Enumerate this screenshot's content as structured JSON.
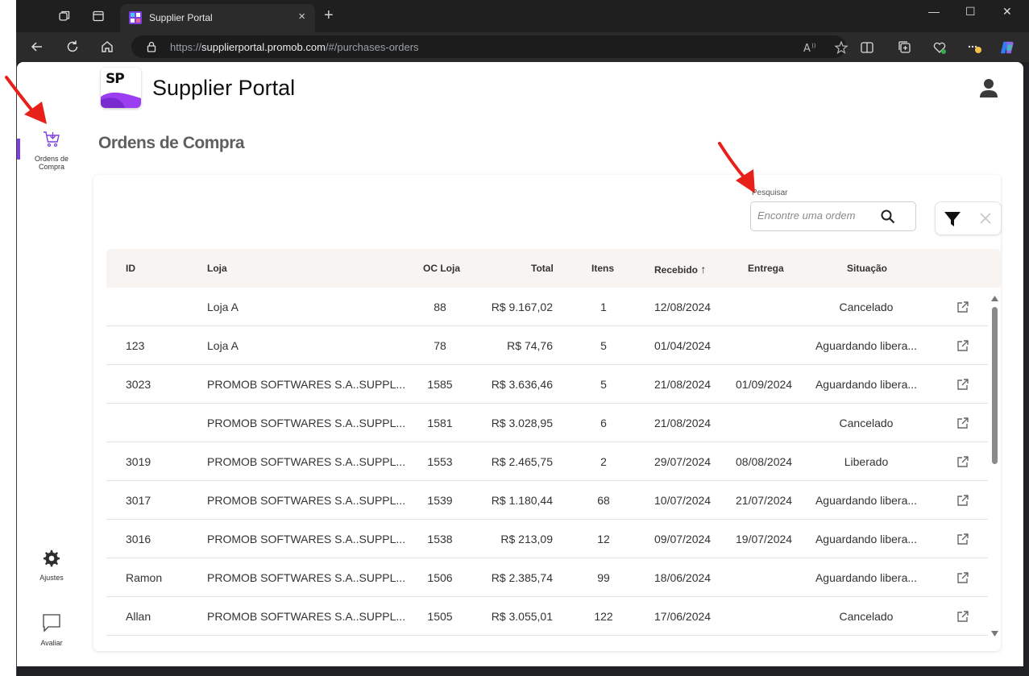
{
  "browser": {
    "tab_title": "Supplier Portal",
    "tab_close": "×",
    "new_tab": "+",
    "url_scheme": "https://",
    "url_host": "supplierportal.promob.com",
    "url_path": "/#/purchases-orders",
    "window_controls": [
      "—",
      "☐",
      "✕"
    ]
  },
  "app": {
    "logo_text": "SP",
    "title": "Supplier Portal"
  },
  "sidebar": {
    "items": [
      {
        "label": "Ordens de Compra",
        "icon": "cart-icon",
        "active": true
      },
      {
        "label": "Ajustes",
        "icon": "gear-icon"
      },
      {
        "label": "Avaliar",
        "icon": "chat-icon"
      }
    ]
  },
  "page": {
    "title": "Ordens de Compra"
  },
  "search": {
    "label": "Pesquisar",
    "placeholder": "Encontre uma ordem"
  },
  "table": {
    "columns": [
      "ID",
      "Loja",
      "OC Loja",
      "Total",
      "Itens",
      "Recebido",
      "Entrega",
      "Situação"
    ],
    "sort_indicator": "↑",
    "rows": [
      {
        "id": "",
        "loja": "Loja  A",
        "oc_loja": "88",
        "total": "R$ 9.167,02",
        "itens": "1",
        "recebido": "12/08/2024",
        "entrega": "",
        "situacao": "Cancelado"
      },
      {
        "id": "123",
        "loja": "Loja  A",
        "oc_loja": "78",
        "total": "R$ 74,76",
        "itens": "5",
        "recebido": "01/04/2024",
        "entrega": "",
        "situacao": "Aguardando libera..."
      },
      {
        "id": "3023",
        "loja": "PROMOB SOFTWARES S.A..SUPPL...",
        "oc_loja": "1585",
        "total": "R$ 3.636,46",
        "itens": "5",
        "recebido": "21/08/2024",
        "entrega": "01/09/2024",
        "situacao": "Aguardando libera..."
      },
      {
        "id": "",
        "loja": "PROMOB SOFTWARES S.A..SUPPL...",
        "oc_loja": "1581",
        "total": "R$ 3.028,95",
        "itens": "6",
        "recebido": "21/08/2024",
        "entrega": "",
        "situacao": "Cancelado"
      },
      {
        "id": "3019",
        "loja": "PROMOB SOFTWARES S.A..SUPPL...",
        "oc_loja": "1553",
        "total": "R$ 2.465,75",
        "itens": "2",
        "recebido": "29/07/2024",
        "entrega": "08/08/2024",
        "situacao": "Liberado"
      },
      {
        "id": "3017",
        "loja": "PROMOB SOFTWARES S.A..SUPPL...",
        "oc_loja": "1539",
        "total": "R$ 1.180,44",
        "itens": "68",
        "recebido": "10/07/2024",
        "entrega": "21/07/2024",
        "situacao": "Aguardando libera..."
      },
      {
        "id": "3016",
        "loja": "PROMOB SOFTWARES S.A..SUPPL...",
        "oc_loja": "1538",
        "total": "R$ 213,09",
        "itens": "12",
        "recebido": "09/07/2024",
        "entrega": "19/07/2024",
        "situacao": "Aguardando libera..."
      },
      {
        "id": "Ramon",
        "loja": "PROMOB SOFTWARES S.A..SUPPL...",
        "oc_loja": "1506",
        "total": "R$ 2.385,74",
        "itens": "99",
        "recebido": "18/06/2024",
        "entrega": "",
        "situacao": "Aguardando libera..."
      },
      {
        "id": "Allan",
        "loja": "PROMOB SOFTWARES S.A..SUPPL...",
        "oc_loja": "1505",
        "total": "R$ 3.055,01",
        "itens": "122",
        "recebido": "17/06/2024",
        "entrega": "",
        "situacao": "Cancelado"
      }
    ]
  },
  "colors": {
    "accent": "#7b3fe4",
    "annotation": "#e8201a",
    "table_header_bg": "#f8f4f1"
  }
}
